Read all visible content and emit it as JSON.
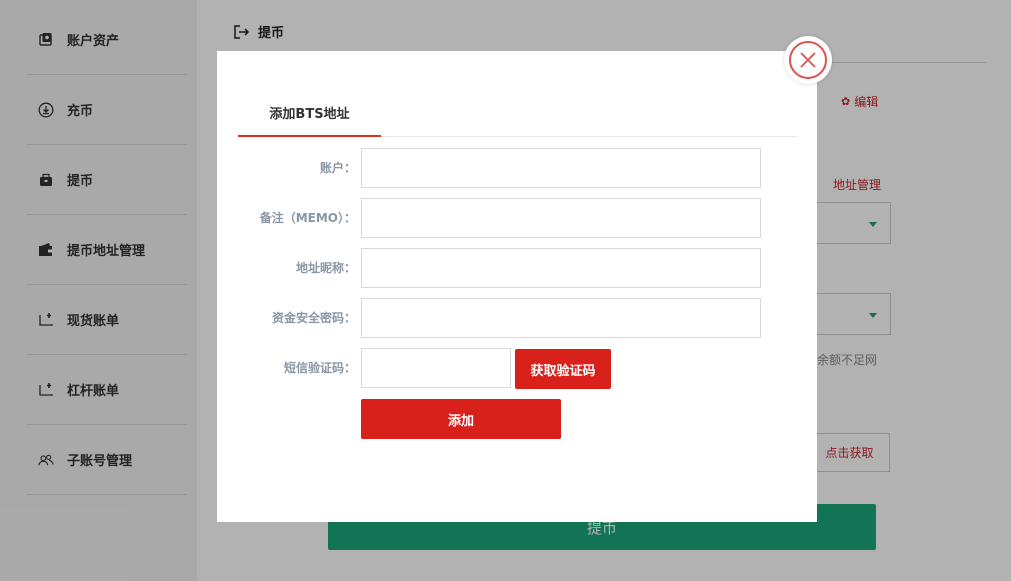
{
  "sidebar": {
    "items": [
      {
        "label": "账户资产",
        "icon": "asset-icon"
      },
      {
        "label": "充币",
        "icon": "deposit-icon"
      },
      {
        "label": "提币",
        "icon": "withdraw-icon"
      },
      {
        "label": "提币地址管理",
        "icon": "wallet-icon"
      },
      {
        "label": "现货账单",
        "icon": "bill-icon"
      },
      {
        "label": "杠杆账单",
        "icon": "bill-icon"
      },
      {
        "label": "子账号管理",
        "icon": "users-icon"
      }
    ]
  },
  "main": {
    "title": "提币",
    "edit_label": "编辑",
    "address_mgmt_label": "地址管理",
    "balance_note": "余额不足网",
    "get_code_label": "点击获取",
    "submit_label": "提币"
  },
  "modal": {
    "tab_label": "添加BTS地址",
    "fields": [
      {
        "label": "账户：",
        "value": "",
        "placeholder": ""
      },
      {
        "label": "备注（MEMO）：",
        "value": "",
        "placeholder": ""
      },
      {
        "label": "地址昵称：",
        "value": "",
        "placeholder": ""
      },
      {
        "label": "资金安全密码：",
        "value": "",
        "placeholder": ""
      },
      {
        "label": "短信验证码：",
        "value": "",
        "placeholder": ""
      }
    ],
    "sms_button_label": "获取验证码",
    "add_button_label": "添加"
  },
  "colors": {
    "accent_red": "#d9211c",
    "accent_green": "#1aa57a",
    "close_ring": "#d9534f"
  }
}
